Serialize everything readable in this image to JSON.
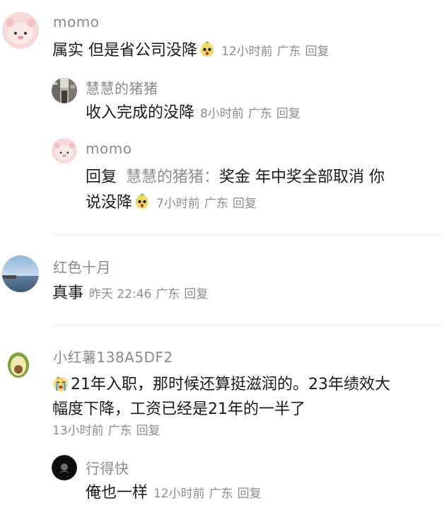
{
  "comments": [
    {
      "name": "momo",
      "text": "属实 但是省公司没降",
      "time": "12小时前",
      "location": "广东",
      "reply": "回复",
      "replies": [
        {
          "name": "慧慧的猪猪",
          "text": "收入完成的没降",
          "time": "8小时前",
          "location": "广东",
          "reply": "回复"
        },
        {
          "name": "momo",
          "reply_prefix": "回复",
          "mention": "慧慧的猪猪：",
          "text_line1": "奖金 年中奖全部取消 你",
          "text_line2": "说没降",
          "time": "7小时前",
          "location": "广东",
          "reply": "回复"
        }
      ]
    },
    {
      "name": "红色十月",
      "text": "真事",
      "time": "昨天 22:46",
      "location": "广东",
      "reply": "回复"
    },
    {
      "name": "小红薯138A5DF2",
      "text_line1": "21年入职，那时候还算挺滋润的。23年绩效大",
      "text_line2": "幅度下降，工资已经是21年的一半了",
      "time": "13小时前",
      "location": "广东",
      "reply": "回复",
      "replies": [
        {
          "name": "行得快",
          "text": "俺也一样",
          "time": "12小时前",
          "location": "广东",
          "reply": "回复"
        }
      ]
    }
  ],
  "icons": {
    "momo_avatar": "pink-bear-avatar",
    "huihui_avatar": "street-photo-avatar",
    "hongse_avatar": "sky-photo-avatar",
    "xiaohongshu_avatar": "avocado-avatar",
    "xingdekuai_avatar": "black-avatar",
    "emoji": "shocked-bean-emoji",
    "crying_emoji": "crying-face-emoji"
  },
  "colors": {
    "name": "#8a8a8a",
    "text": "#1a1a1a",
    "meta": "#8d8d8d",
    "divider": "#ececec"
  }
}
